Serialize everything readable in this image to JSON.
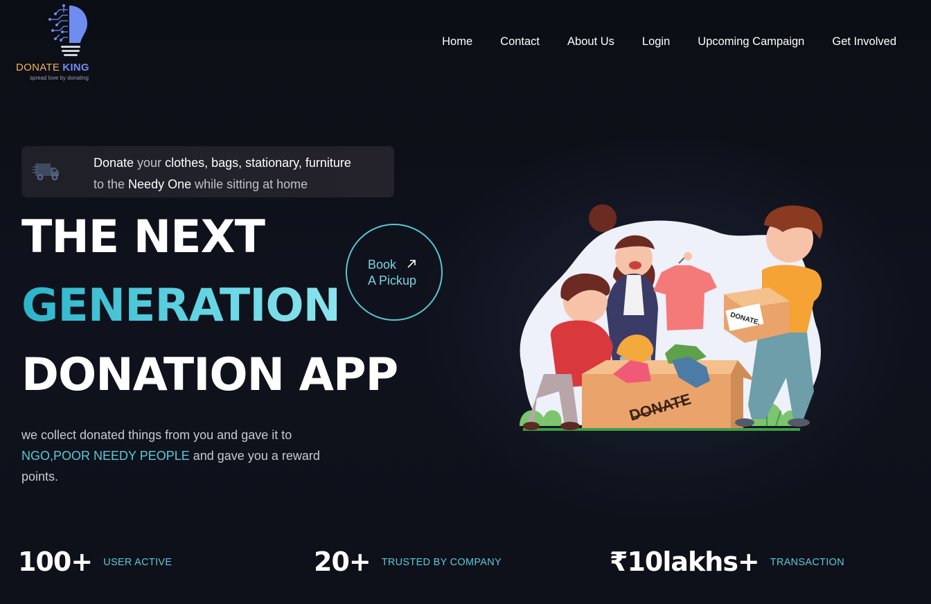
{
  "brand": {
    "name_part1": "DONATE",
    "name_part2": "KING",
    "tagline": "spread love by donating"
  },
  "nav": {
    "items": [
      "Home",
      "Contact",
      "About Us",
      "Login",
      "Upcoming Campaign",
      "Get Involved"
    ]
  },
  "promo": {
    "w1": "Donate",
    "w2": " your ",
    "w3": "clothes, bags, stationary, furniture",
    "w4": "to the ",
    "w5": "Needy One",
    "w6": " while sitting at home"
  },
  "hero": {
    "line1": "THE NEXT",
    "line2": "GENERATION",
    "line3": "DONATION APP",
    "desc_part1": "we collect donated things from you and gave it to ",
    "desc_highlight": "NGO,POOR NEEDY PEOPLE",
    "desc_part2": " and gave you a reward points."
  },
  "book_button": {
    "line1": "Book",
    "line2": "A Pickup"
  },
  "illustration": {
    "box_label_front": "DONATE",
    "box_label_side": "DONATE."
  },
  "stats": [
    {
      "value": "100+",
      "label": "USER ACTIVE"
    },
    {
      "value": "20+",
      "label": "TRUSTED BY COMPANY"
    },
    {
      "value": "₹10lakhs+",
      "label": "TRANSACTION"
    }
  ],
  "colors": {
    "accent": "#5dc9d8",
    "brand_orange": "#f2b157",
    "brand_blue": "#6f8cf0",
    "background": "#0e111a"
  },
  "icons": {
    "logo": "lightbulb-circuit-icon",
    "promo": "truck-icon",
    "book": "arrow-up-right-icon"
  }
}
